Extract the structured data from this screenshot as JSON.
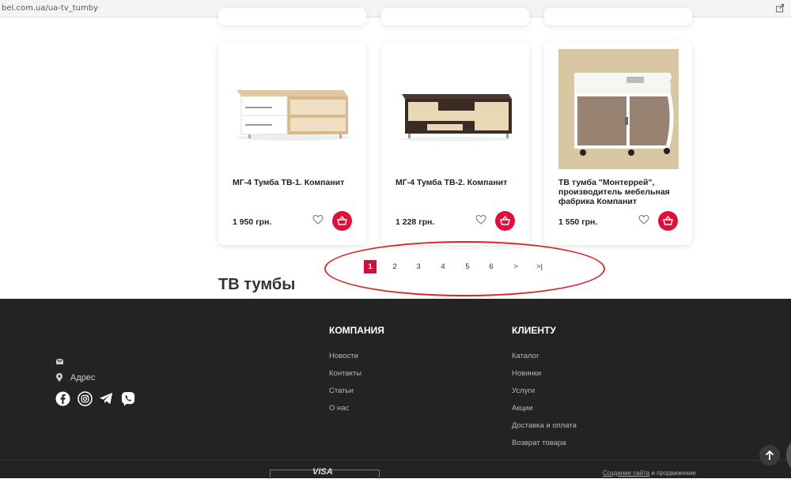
{
  "browser": {
    "url": "bel.com.ua/ua-tv_tumby"
  },
  "products": [
    {
      "title": "МГ-4 Тумба ТВ-1. Компанит",
      "price": "1 950 грн."
    },
    {
      "title": "МГ-4 Тумба ТВ-2. Компанит",
      "price": "1 228 грн."
    },
    {
      "title": "ТВ тумба \"Монтеррей\", производитель мебельная фабрика Компанит",
      "price": "1 550 грн."
    }
  ],
  "pagination": {
    "pages": [
      "1",
      "2",
      "3",
      "4",
      "5",
      "6",
      ">",
      ">|"
    ],
    "current": "1"
  },
  "section_title": "ТВ тумбы",
  "footer": {
    "company": {
      "heading": "КОМПАНИЯ",
      "links": [
        "Новости",
        "Контакты",
        "Статьи",
        "О нас"
      ]
    },
    "client": {
      "heading": "КЛИЕНТУ",
      "links": [
        "Каталог",
        "Новинки",
        "Услуги",
        "Акции",
        "Доставка и оплата",
        "Возврат товара"
      ]
    },
    "address": "Адрес",
    "payment": "VISA",
    "credits_link": "Создание сайта",
    "credits_rest": " и продвижение"
  },
  "colors": {
    "accent": "#d40b3c",
    "footer_bg": "#232323",
    "annotation": "#d62828"
  }
}
